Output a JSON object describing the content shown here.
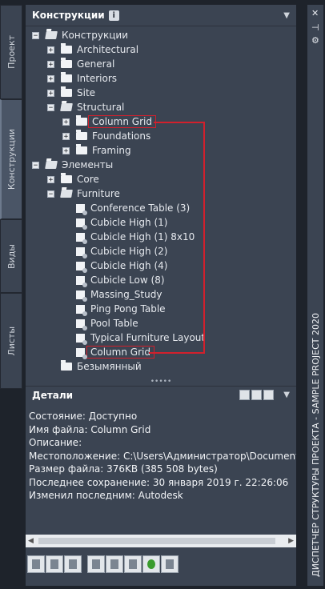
{
  "left_tabs": [
    {
      "label": "Проект",
      "active": false
    },
    {
      "label": "Конструкции",
      "active": true
    },
    {
      "label": "Виды",
      "active": false
    },
    {
      "label": "Листы",
      "active": false
    }
  ],
  "panel": {
    "title": "Конструкции",
    "title_icon": "info-icon",
    "dropdown_icon": "chevron-down-icon"
  },
  "tree": [
    {
      "label": "Конструкции",
      "toggle": "−",
      "icon": "folder-open-icon"
    },
    {
      "label": "Architectural",
      "toggle": "+",
      "icon": "folder-icon"
    },
    {
      "label": "General",
      "toggle": "+",
      "icon": "folder-icon"
    },
    {
      "label": "Interiors",
      "toggle": "+",
      "icon": "folder-icon"
    },
    {
      "label": "Site",
      "toggle": "+",
      "icon": "folder-icon"
    },
    {
      "label": "Structural",
      "toggle": "−",
      "icon": "folder-open-icon"
    },
    {
      "label": "Column Grid",
      "toggle": "+",
      "icon": "folder-icon",
      "highlighted": true
    },
    {
      "label": "Foundations",
      "toggle": "+",
      "icon": "folder-icon"
    },
    {
      "label": "Framing",
      "toggle": "+",
      "icon": "folder-icon"
    },
    {
      "label": "Элементы",
      "toggle": "−",
      "icon": "folder-open-icon"
    },
    {
      "label": "Core",
      "toggle": "+",
      "icon": "folder-icon"
    },
    {
      "label": "Furniture",
      "toggle": "−",
      "icon": "folder-open-icon"
    },
    {
      "label": "Conference Table (3)",
      "icon": "element-icon"
    },
    {
      "label": "Cubicle High (1)",
      "icon": "element-icon"
    },
    {
      "label": "Cubicle High (1) 8x10",
      "icon": "element-icon"
    },
    {
      "label": "Cubicle High (2)",
      "icon": "element-icon"
    },
    {
      "label": "Cubicle High (4)",
      "icon": "element-icon"
    },
    {
      "label": "Cubicle Low (8)",
      "icon": "element-icon"
    },
    {
      "label": "Massing_Study",
      "icon": "element-icon"
    },
    {
      "label": "Ping Pong Table",
      "icon": "element-icon"
    },
    {
      "label": "Pool Table",
      "icon": "element-icon"
    },
    {
      "label": "Typical Furniture Layout",
      "icon": "element-icon"
    },
    {
      "label": "Column Grid",
      "icon": "element-icon",
      "highlighted": true
    },
    {
      "label": "Безымянный",
      "icon": "folder-icon"
    }
  ],
  "details": {
    "title": "Детали",
    "icons": [
      "preview-icon",
      "details-view-icon",
      "search-icon"
    ],
    "lines": [
      "Состояние: Доступно",
      "Имя файла: Column Grid",
      "Описание:",
      "Местоположение: C:\\Users\\Администратор\\Documents\\Autodesk",
      "Размер файла: 376KB (385 508 bytes)",
      "Последнее сохранение: 30 января 2019 г.  22:26:06",
      "Изменил последним: Autodesk"
    ]
  },
  "toolbar": [
    {
      "icon": "new-construct-icon"
    },
    {
      "icon": "new-category-icon"
    },
    {
      "icon": "new-element-icon"
    },
    {
      "icon": "properties-icon"
    },
    {
      "icon": "filter-icon"
    },
    {
      "icon": "xref-icon"
    },
    {
      "icon": "refresh-icon"
    },
    {
      "icon": "repath-icon"
    }
  ],
  "right_strip": {
    "title": "ДИСПЕТЧЕР СТРУКТУРЫ ПРОЕКТА - SAMPLE PROJECT 2020",
    "icons": [
      "close-icon",
      "pin-icon",
      "settings-icon"
    ]
  },
  "colors": {
    "highlight": "#d2202c",
    "panel_bg": "#3b4452",
    "background": "#1e232b"
  }
}
